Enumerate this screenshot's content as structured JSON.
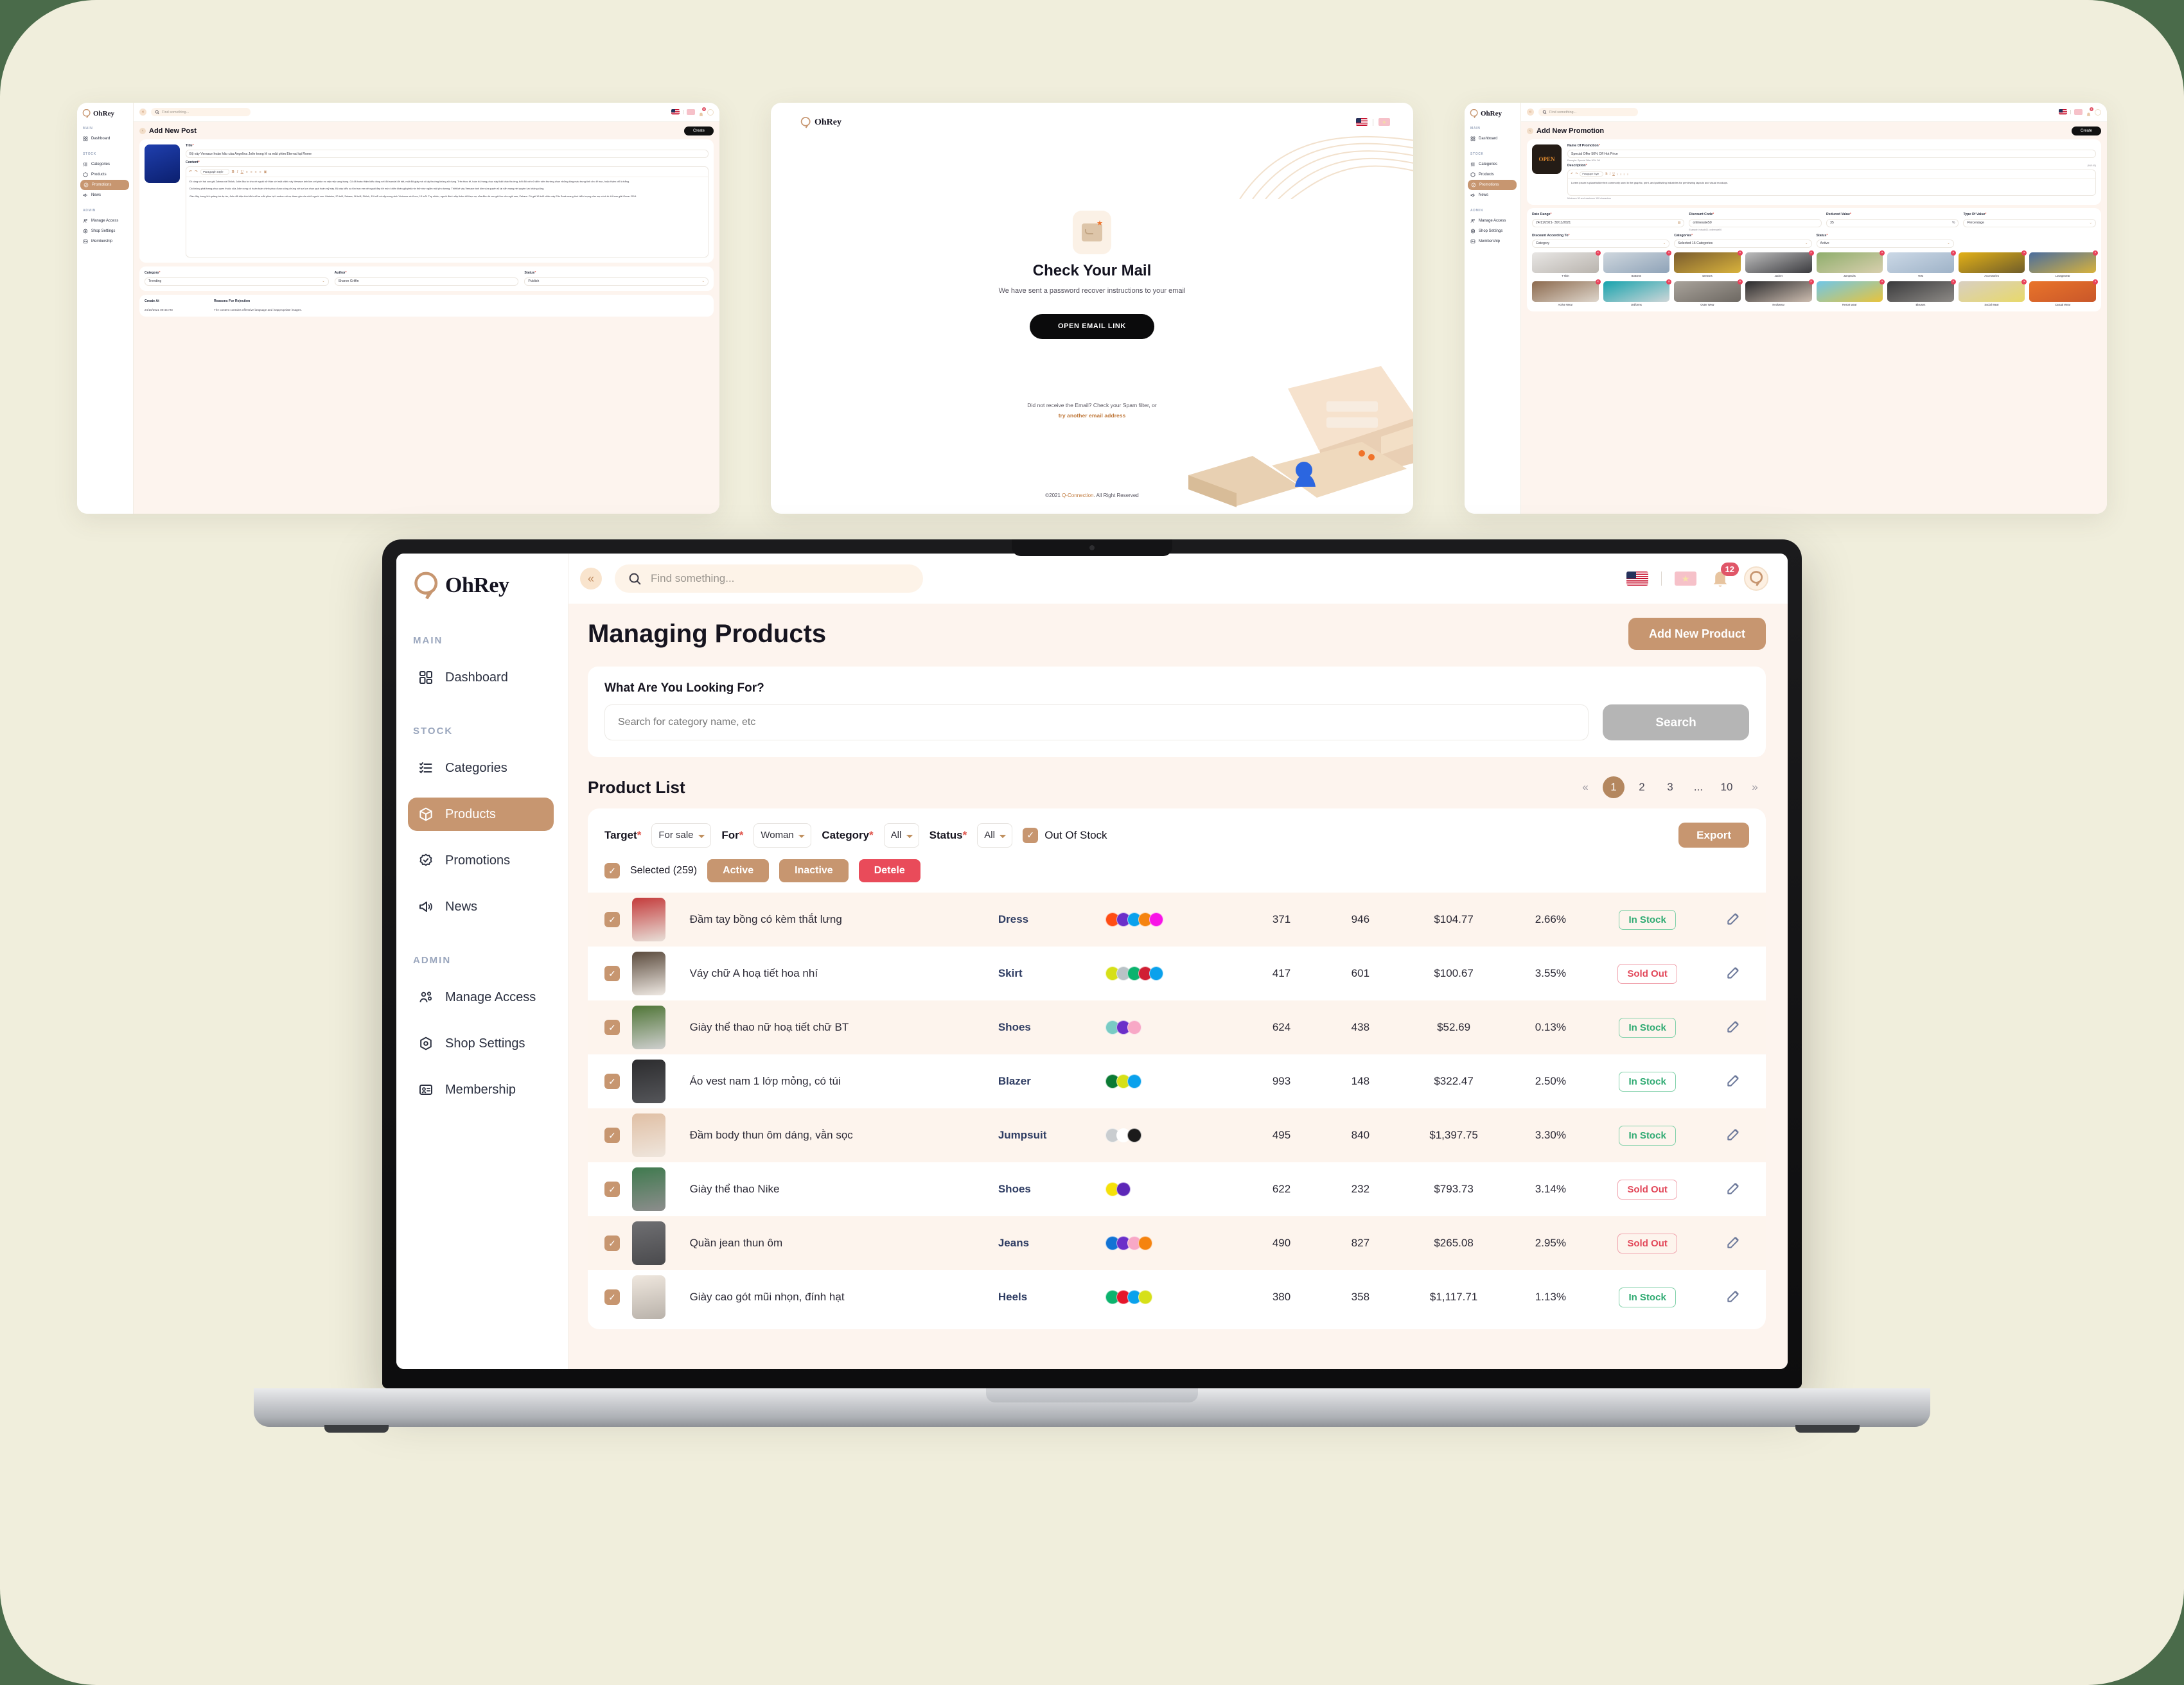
{
  "brand": {
    "name": "OhRey"
  },
  "laptop_app": {
    "topbar": {
      "search_placeholder": "Find something...",
      "collapse_icon": "chevron-double-left-icon",
      "search_icon": "search-icon",
      "flag_us": "us-flag-icon",
      "flag_vn": "vn-flag-icon",
      "bell_icon": "bell-icon",
      "notification_count": "12",
      "avatar": "user-avatar"
    },
    "sidebar": {
      "sections": [
        {
          "label": "MAIN",
          "items": [
            {
              "label": "Dashboard",
              "icon": "dashboard-grid-icon",
              "active": false
            }
          ]
        },
        {
          "label": "STOCK",
          "items": [
            {
              "label": "Categories",
              "icon": "list-check-icon",
              "active": false
            },
            {
              "label": "Products",
              "icon": "box-icon",
              "active": true
            },
            {
              "label": "Promotions",
              "icon": "badge-check-icon",
              "active": false
            },
            {
              "label": "News",
              "icon": "megaphone-icon",
              "active": false
            }
          ]
        },
        {
          "label": "ADMIN",
          "items": [
            {
              "label": "Manage Access",
              "icon": "users-icon",
              "active": false
            },
            {
              "label": "Shop Settings",
              "icon": "hexagon-gear-icon",
              "active": false
            },
            {
              "label": "Membership",
              "icon": "id-card-icon",
              "active": false
            }
          ]
        }
      ]
    },
    "page": {
      "title": "Managing Products",
      "add_button": "Add New Product",
      "search_card": {
        "heading": "What Are You Looking For?",
        "input_placeholder": "Search for category name, etc",
        "input_value": "",
        "search_button": "Search"
      },
      "list_title": "Product List",
      "pagination": {
        "prev": "«",
        "next": "»",
        "pages": [
          "1",
          "2",
          "3",
          "...",
          "10"
        ],
        "current": "1"
      },
      "filters": [
        {
          "label": "Target",
          "required": true,
          "value": "For sale"
        },
        {
          "label": "For",
          "required": true,
          "value": "Woman"
        },
        {
          "label": "Category",
          "required": true,
          "value": "All"
        },
        {
          "label": "Status",
          "required": true,
          "value": "All"
        }
      ],
      "out_of_stock_label": "Out Of Stock",
      "out_of_stock_checked": true,
      "export_button": "Export",
      "selected_label": "Selected (259)",
      "bulk_actions": [
        {
          "label": "Active",
          "style": "tan"
        },
        {
          "label": "Inactive",
          "style": "tan"
        },
        {
          "label": "Detele",
          "style": "red"
        }
      ],
      "rows": [
        {
          "checked": true,
          "name": "Đầm tay bồng có kèm thắt lưng",
          "category": "Dress",
          "colors": [
            "#ff4d14",
            "#6b2fc9",
            "#0aa1ec",
            "#f5830f",
            "#f814e6"
          ],
          "n1": "371",
          "n2": "946",
          "price": "$104.77",
          "rate": "2.66%",
          "status": "In Stock",
          "thumb_top": "#c43b3b",
          "thumb_bot": "#e8dfd8"
        },
        {
          "checked": true,
          "name": "Váy chữ A hoạ tiết hoa nhí",
          "category": "Skirt",
          "colors": [
            "#d6e018",
            "#b9c2c6",
            "#0cb36e",
            "#d01f34",
            "#0aa1ec"
          ],
          "n1": "417",
          "n2": "601",
          "price": "$100.67",
          "rate": "3.55%",
          "status": "Sold Out",
          "thumb_top": "#5a4a3c",
          "thumb_bot": "#efe9e3"
        },
        {
          "checked": true,
          "name": "Giày thể thao nữ hoạ tiết chữ BT",
          "category": "Shoes",
          "colors": [
            "#79cbc4",
            "#6b2fc9",
            "#f8a8c6"
          ],
          "n1": "624",
          "n2": "438",
          "price": "$52.69",
          "rate": "0.13%",
          "status": "In Stock",
          "thumb_top": "#4f7536",
          "thumb_bot": "#cfcfcf"
        },
        {
          "checked": true,
          "name": "Áo vest nam 1 lớp mỏng, có túi",
          "category": "Blazer",
          "colors": [
            "#0b7a34",
            "#d6e018",
            "#0aa1ec"
          ],
          "n1": "993",
          "n2": "148",
          "price": "$322.47",
          "rate": "2.50%",
          "status": "In Stock",
          "thumb_top": "#2c2c2e",
          "thumb_bot": "#55565a"
        },
        {
          "checked": true,
          "name": "Đầm body thun ôm dáng, vằn sọc",
          "category": "Jumpsuit",
          "colors": [
            "#c9cdd0",
            "#ffffff",
            "#1b1b1b"
          ],
          "n1": "495",
          "n2": "840",
          "price": "$1,397.75",
          "rate": "3.30%",
          "status": "In Stock",
          "thumb_top": "#e0bfa4",
          "thumb_bot": "#efe6dd"
        },
        {
          "checked": true,
          "name": "Giày thể thao Nike",
          "category": "Shoes",
          "colors": [
            "#f5e10a",
            "#5d27b8"
          ],
          "n1": "622",
          "n2": "232",
          "price": "$793.73",
          "rate": "3.14%",
          "status": "Sold Out",
          "thumb_top": "#3f7a4e",
          "thumb_bot": "#8d8d8d"
        },
        {
          "checked": true,
          "name": "Quần jean thun ôm",
          "category": "Jeans",
          "colors": [
            "#1273d4",
            "#6b2fc9",
            "#f8a8c6",
            "#f5830f"
          ],
          "n1": "490",
          "n2": "827",
          "price": "$265.08",
          "rate": "2.95%",
          "status": "Sold Out",
          "thumb_top": "#6f6f72",
          "thumb_bot": "#4a4a4d"
        },
        {
          "checked": true,
          "name": "Giày cao gót mũi nhọn, đính hạt",
          "category": "Heels",
          "colors": [
            "#0cb36e",
            "#e5162b",
            "#0aa1ec",
            "#d6e018"
          ],
          "n1": "380",
          "n2": "358",
          "price": "$1,117.71",
          "rate": "1.13%",
          "status": "In Stock",
          "thumb_top": "#efe7de",
          "thumb_bot": "#b9b2aa"
        }
      ]
    }
  },
  "mini_post": {
    "search_placeholder": "Find something...",
    "title": "Add New Post",
    "create_button": "Create",
    "sidebar": {
      "sections": [
        {
          "label": "MAIN",
          "items": [
            {
              "label": "Dashboard",
              "active": false
            }
          ]
        },
        {
          "label": "STOCK",
          "items": [
            {
              "label": "Categories",
              "active": false
            },
            {
              "label": "Products",
              "active": false
            },
            {
              "label": "Promotions",
              "active": true
            },
            {
              "label": "News",
              "active": false
            }
          ]
        },
        {
          "label": "ADMIN",
          "items": [
            {
              "label": "Manage Access",
              "active": false
            },
            {
              "label": "Shop Settings",
              "active": false
            },
            {
              "label": "Membership",
              "active": false
            }
          ]
        }
      ]
    },
    "form": {
      "title_label": "Title",
      "title_value": "Bộ váy Versace hoàn hảo của Angelina Jolie trong lễ ra mắt phim Eternal tại Rome",
      "content_label": "Content",
      "toolbar_style": "Paragraph Style",
      "paragraph1": "Đi cùng với hai con gái Zahara và Shiloh, Jolie đầu tư cho vẻ ngoài nữ thần với một chiếc váy Versace ánh kim với phần eo xếp nếp sang trọng. Cô đã hoàn thiện kiểu dáng với đôi sandal đế bệt, một đôi giày mà cô ấy thường không sử dụng. Trên thực tế, toàn bộ trang phục này thật khác thường, bởi đối với nữ diễn viên thường chọn những tông màu trung tính cho lễ trao, hoặc thảm chỉ là trắng.",
      "paragraph2": "Dù không phải trang phục quen thuộc của Jolie xong cô hoàn toàn chinh phục được công chúng với sự lựa chọn quá hoàn mỹ này. Bộ váy kiểu sa tôn trọn vẹn vẻ ngoài đẹp tới mức khiến khán giả phải nín thở như ngắm một pho tượng. Thiết kế váy Versace ánh kim vừa quyến rũ lại vẫn mang nét quyền lực không cũng.",
      "paragraph3": "Gần đây, trong khi quảng bá dự án, Jolie đã diện thời đồ buổi ra mắt phim tại London với sự tham gia của cả 6 người con: Maddox, 20 tuổi, Zahara, 16 tuổi, Shiloh, 15 tuổi và cặp song sinh Vivienne và Knox, 13 tuổi. Tuy nhiên, người đánh cắp thảm đỏ thực sự của đêm là con gái lớn của ngôi sao, Zahara. Cô gái 16 tuổi chiếc váy Elie Saab mang tính biểu tượng của mẹ mình từ Lễ trao giải Oscar 2014.",
      "category_label": "Category",
      "category_value": "Trending",
      "author_label": "Author",
      "author_value": "Sharon Griffin",
      "status_label": "Status",
      "status_value": "Publish",
      "create_at_label": "Create At",
      "create_at_value": "24/10/2021 09:45 AM",
      "rejection_label": "Reasons For Rejection",
      "rejection_value": "The content contains offensive language and inappropriate images."
    }
  },
  "mini_mail": {
    "flag_us": "us-flag-icon",
    "flag_vn": "vn-flag-icon",
    "title": "Check Your Mail",
    "subtitle": "We have sent a password recover instructions to your email",
    "button": "OPEN EMAIL LINK",
    "hint": "Did not receive the Email? Check your Spam filter, or",
    "link": "try another email address",
    "footer_left": "©2021 ",
    "footer_brand": "Q-Connection",
    "footer_right": ". All Right Reserved"
  },
  "mini_promo": {
    "search_placeholder": "Find something...",
    "title": "Add New Promotion",
    "create_button": "Create",
    "sidebar": {
      "sections": [
        {
          "label": "MAIN",
          "items": [
            {
              "label": "Dashboard",
              "active": false
            }
          ]
        },
        {
          "label": "STOCK",
          "items": [
            {
              "label": "Categories",
              "active": false
            },
            {
              "label": "Products",
              "active": false
            },
            {
              "label": "Promotions",
              "active": true
            },
            {
              "label": "News",
              "active": false
            }
          ]
        },
        {
          "label": "ADMIN",
          "items": [
            {
              "label": "Manage Access",
              "active": false
            },
            {
              "label": "Shop Settings",
              "active": false
            },
            {
              "label": "Membership",
              "active": false
            }
          ]
        }
      ]
    },
    "form": {
      "name_label": "Name Of Promotion",
      "name_value": "Special Offer 50% Off Hot Price",
      "name_example": "Example: Special Offer 50% Off",
      "desc_label": "Description",
      "desc_counter": "(94/100)",
      "toolbar_style": "Paragraph Style",
      "desc_value": "Lorem ipsum is placeholder text commonly used in the graphic, print, and publishing industries for previewing layouts and visual mockups.",
      "desc_hint": "Minimum 30 and maximum 100 characters",
      "date_label": "Date Range",
      "date_value": "24/11/2021- 30/11/2021",
      "code_label": "Discount Code",
      "code_value": "onlinesale50",
      "code_example": "Example: hotsale20, onlinesale50",
      "reduced_label": "Reduced Value",
      "reduced_value": "35",
      "reduced_unit": "%",
      "type_label": "Type Of Value",
      "type_value": "Percentage",
      "according_label": "Discount According To",
      "according_value": "Category",
      "categories_label": "Categories",
      "categories_value": "Selected 16 Categories",
      "status_label": "Status",
      "status_value": "Active",
      "category_tiles": [
        {
          "label": "T-shirt",
          "c1": "#e8e6e4",
          "c2": "#b9b4ae"
        },
        {
          "label": "Bottoms",
          "c1": "#cfd7de",
          "c2": "#8fa3b8"
        },
        {
          "label": "Dresses",
          "c1": "#7a5c2e",
          "c2": "#d8b23c"
        },
        {
          "label": "Jacket",
          "c1": "#bdbdbd",
          "c2": "#3b3b3f"
        },
        {
          "label": "Jumpsuits",
          "c1": "#8fae6c",
          "c2": "#d8cfae"
        },
        {
          "label": "Vest",
          "c1": "#cbd8e6",
          "c2": "#9fb3c8"
        },
        {
          "label": "Accessories",
          "c1": "#e3b117",
          "c2": "#6f5d2a"
        },
        {
          "label": "Loungewear",
          "c1": "#4a6d9e",
          "c2": "#d8b23c"
        },
        {
          "label": "Active Wear",
          "c1": "#8c6a4e",
          "c2": "#ded6cc"
        },
        {
          "label": "Uniforms",
          "c1": "#17a3ad",
          "c2": "#cfd6d8"
        },
        {
          "label": "Outer Wear",
          "c1": "#a9a39b",
          "c2": "#6d6862"
        },
        {
          "label": "Neckwear",
          "c1": "#2b2b2d",
          "c2": "#cdbdb0"
        },
        {
          "label": "Resort wear",
          "c1": "#6fc7e8",
          "c2": "#e8c43c"
        },
        {
          "label": "Blouses",
          "c1": "#3a3a3c",
          "c2": "#8d8a86"
        },
        {
          "label": "Social Wear",
          "c1": "#d8cfc2",
          "c2": "#e8d96a"
        },
        {
          "label": "Casual Wear",
          "c1": "#e9742a",
          "c2": "#c9572a"
        }
      ]
    }
  }
}
